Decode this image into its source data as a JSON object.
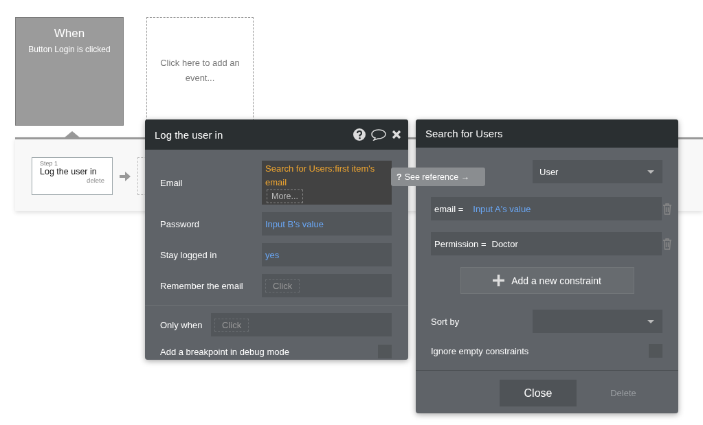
{
  "event": {
    "title": "When",
    "subtitle": "Button Login is clicked"
  },
  "add_event": {
    "label": "Click here to add an event..."
  },
  "workflow": {
    "steps": [
      {
        "step": "Step 1",
        "name": "Log the user in",
        "delete": "delete",
        "selected": true
      }
    ]
  },
  "action_panel": {
    "title": "Log the user in",
    "fields": [
      {
        "label": "Email",
        "kind": "expression",
        "value": "Search for Users:first item's email",
        "more": "More..."
      },
      {
        "label": "Password",
        "kind": "dynamic",
        "value": "Input B's value"
      },
      {
        "label": "Stay logged in",
        "kind": "dynamic",
        "value": "yes"
      },
      {
        "label": "Remember the email",
        "kind": "click",
        "value": "Click"
      }
    ],
    "only_when": {
      "label": "Only when",
      "value": "Click"
    },
    "breakpoint": {
      "label": "Add a breakpoint in debug mode",
      "checked": false
    }
  },
  "tooltip": {
    "icon": "?",
    "label": "See reference →"
  },
  "search_panel": {
    "title": "Search for Users",
    "type": "User",
    "constraints": [
      {
        "field": "email =",
        "kind": "dynamic",
        "value": "Input A's value"
      },
      {
        "field": "Permission =",
        "kind": "static",
        "value": "Doctor"
      }
    ],
    "add_constraint": "Add a new constraint",
    "sort_by": {
      "label": "Sort by"
    },
    "ignore_empty": {
      "label": "Ignore empty constraints",
      "checked": false
    },
    "buttons": [
      {
        "label": "Close",
        "disabled": false
      },
      {
        "label": "Delete",
        "disabled": true
      }
    ]
  }
}
